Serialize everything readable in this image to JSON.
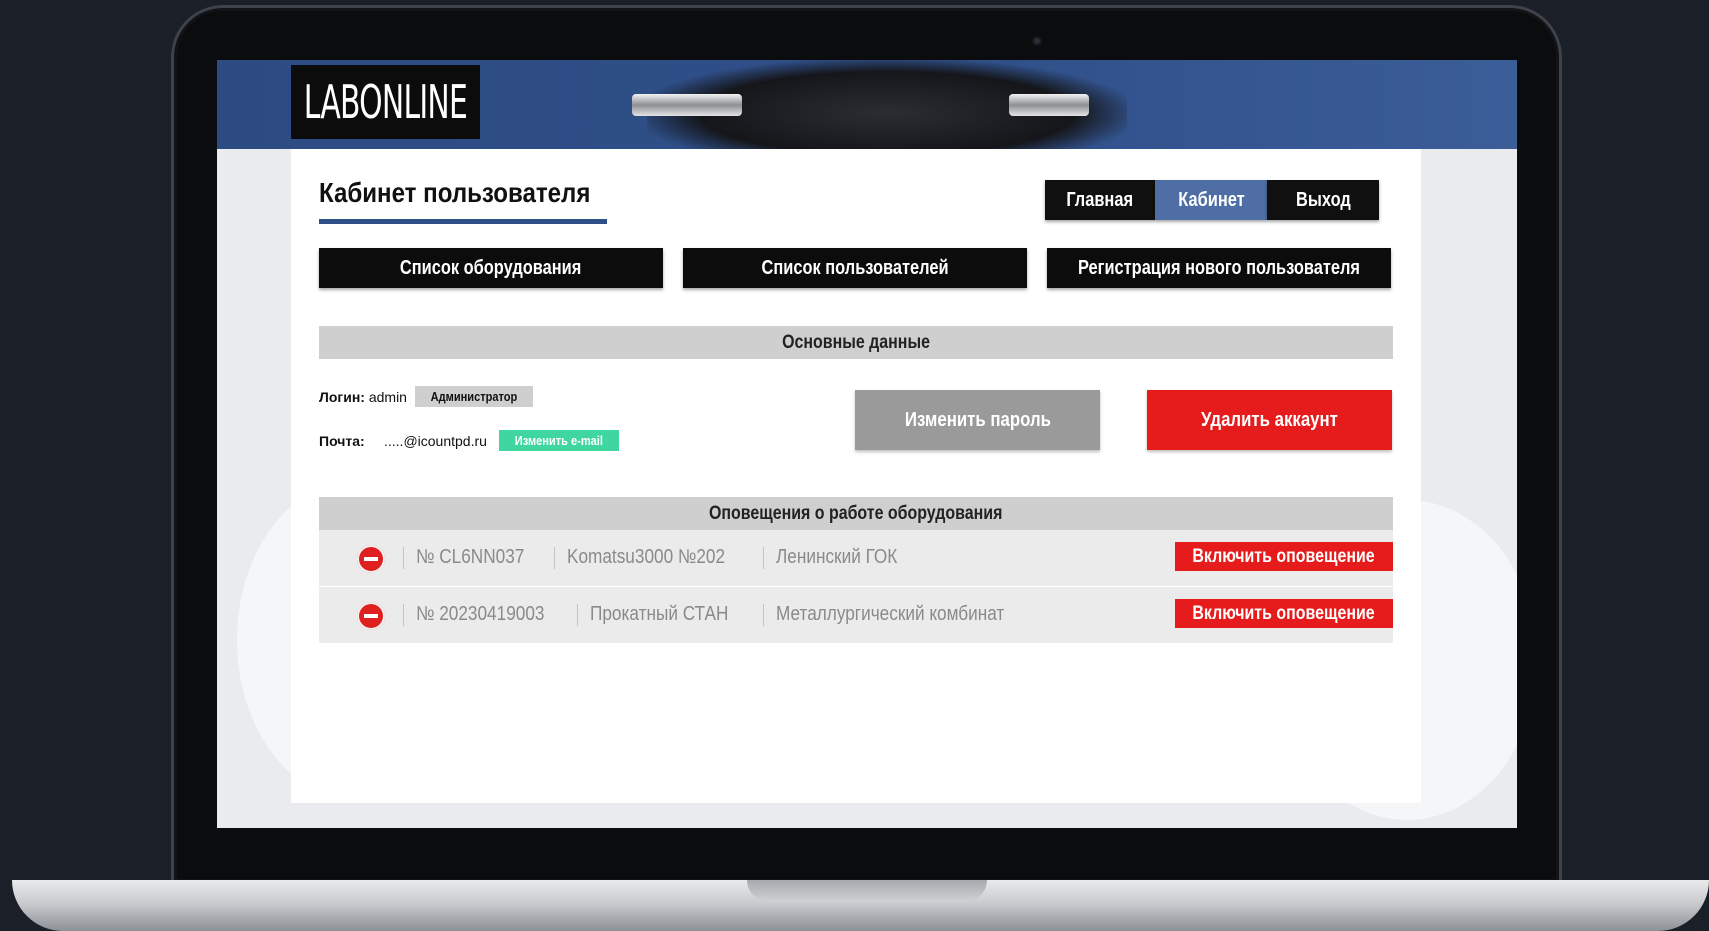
{
  "logo": {
    "text": "LABONLINE"
  },
  "page": {
    "title": "Кабинет пользователя"
  },
  "topnav": {
    "items": [
      {
        "label": "Главная"
      },
      {
        "label": "Кабинет"
      },
      {
        "label": "Выход"
      }
    ]
  },
  "actions": {
    "items": [
      {
        "label": "Список оборудования"
      },
      {
        "label": "Список пользователей"
      },
      {
        "label": "Регистрация нового пользователя"
      }
    ]
  },
  "basic": {
    "header": "Основные данные",
    "login_label": "Логин:",
    "login_value": "admin",
    "role": "Администратор",
    "email_label": "Почта:",
    "email_value": ".....@icountpd.ru",
    "change_email": "Изменить e-mail",
    "change_password": "Изменить пароль",
    "delete_account": "Удалить аккаунт"
  },
  "notifications": {
    "header": "Оповещения о работе оборудования",
    "rows": [
      {
        "serial": "№ CL6NN037",
        "model": "Komatsu3000 №202",
        "site": "Ленинский ГОК",
        "button": "Включить оповещение"
      },
      {
        "serial": "№ 20230419003",
        "model": "Прокатный СТАН",
        "site": "Металлургический комбинат",
        "button": "Включить оповещение"
      }
    ]
  },
  "colors": {
    "header_blue": "#2f4f87",
    "active_tab": "#4f6ea5",
    "danger": "#e61b1b",
    "success": "#3fd6a0"
  }
}
